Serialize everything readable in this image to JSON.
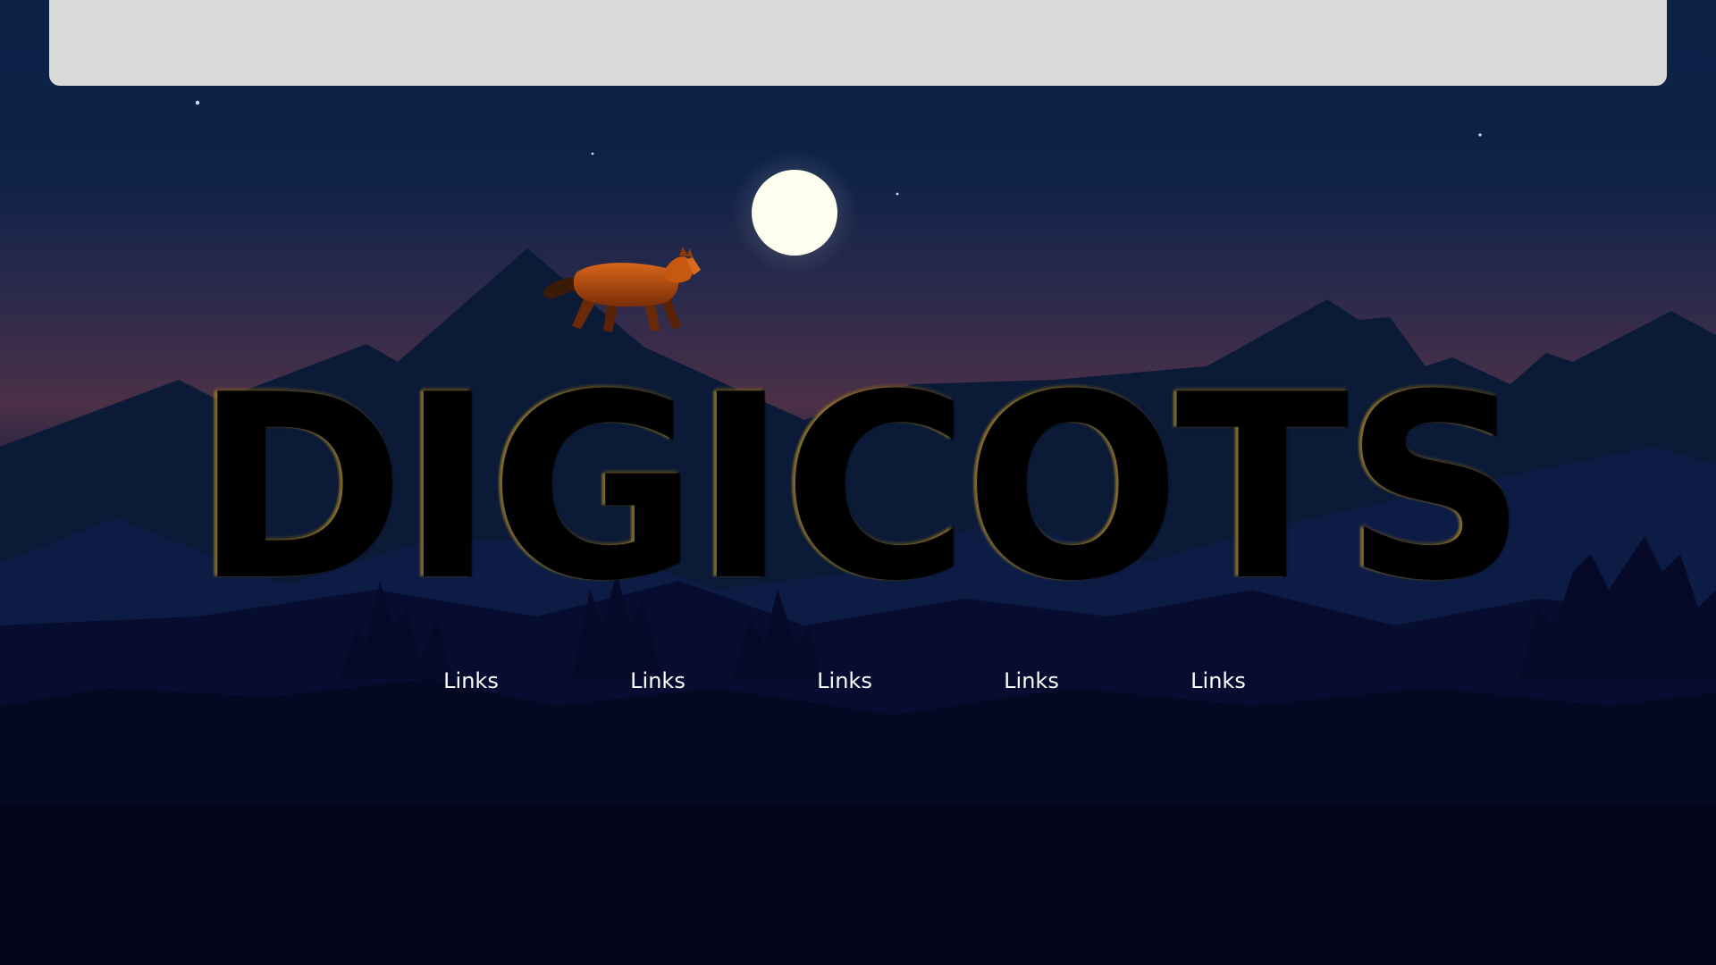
{
  "header": {
    "brand_title": "DIGICOTS"
  },
  "nav": {
    "links": [
      {
        "label": "Links"
      },
      {
        "label": "Links"
      },
      {
        "label": "Links"
      },
      {
        "label": "Links"
      },
      {
        "label": "Links"
      }
    ]
  },
  "colors": {
    "top_bar": "#d9d9d9",
    "sky_top": "#0a1f44",
    "sky_horizon": "#4a2f48",
    "moon": "#fffff0",
    "fox": "#c2560f",
    "link_text": "#ffffff"
  },
  "icons": {
    "moon": "moon-icon",
    "fox": "fox-icon"
  }
}
